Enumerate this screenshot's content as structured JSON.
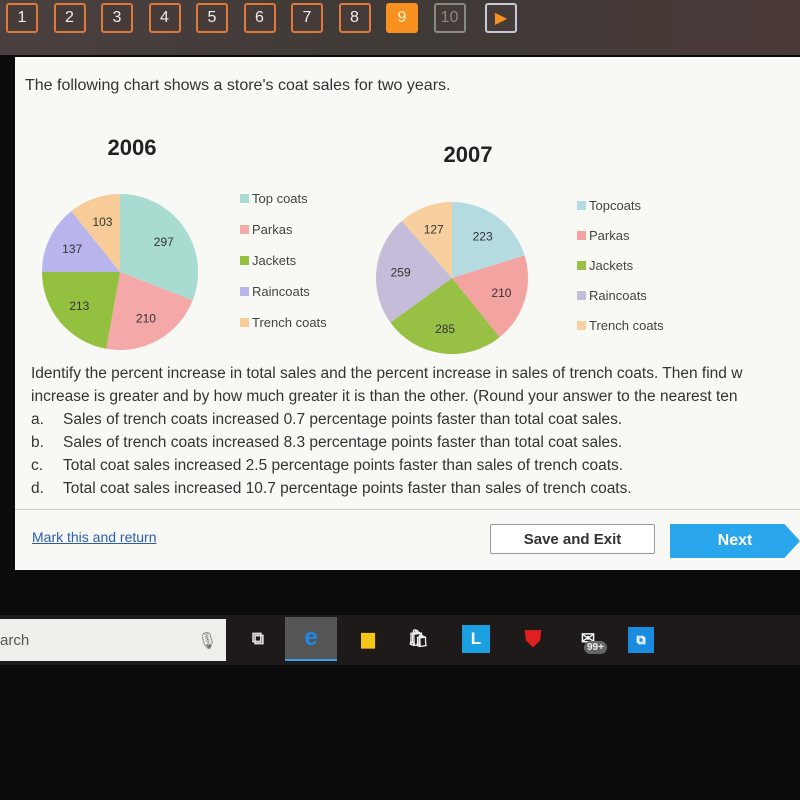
{
  "nav": {
    "questions": [
      "1",
      "2",
      "3",
      "4",
      "5",
      "6",
      "7",
      "8",
      "9",
      "10"
    ],
    "current": "9",
    "disabled": "10",
    "next_icon": "play-arrow-icon"
  },
  "intro": "The following chart shows a store's coat sales for two years.",
  "chart_data": [
    {
      "type": "pie",
      "title": "2006",
      "categories": [
        "Top coats",
        "Parkas",
        "Jackets",
        "Raincoats",
        "Trench coats"
      ],
      "values": [
        297,
        210,
        213,
        137,
        103
      ],
      "colors": [
        "#a8dcd0",
        "#f4a8a8",
        "#94c040",
        "#b8b4ec",
        "#f8cc98"
      ],
      "legend": "right"
    },
    {
      "type": "pie",
      "title": "2007",
      "categories": [
        "Topcoats",
        "Parkas",
        "Jackets",
        "Raincoats",
        "Trench coats"
      ],
      "values": [
        223,
        210,
        285,
        259,
        127
      ],
      "colors": [
        "#b4dce0",
        "#f4a4a0",
        "#98c044",
        "#c4bcd8",
        "#f8d0a0"
      ],
      "legend": "right"
    }
  ],
  "question": {
    "text1": "Identify the percent increase in total sales and the percent increase in sales of trench coats. Then find w",
    "text2": "increase is greater and by how much greater it is than the other. (Round your answer to the nearest ten",
    "options": [
      {
        "letter": "a.",
        "text": "Sales of trench coats increased 0.7 percentage points faster than total coat sales."
      },
      {
        "letter": "b.",
        "text": "Sales of trench coats increased 8.3 percentage points faster than total coat sales."
      },
      {
        "letter": "c.",
        "text": "Total coat sales increased 2.5 percentage points faster than sales of trench coats."
      },
      {
        "letter": "d.",
        "text": "Total coat sales increased 10.7 percentage points faster than sales of trench coats."
      }
    ]
  },
  "footer": {
    "mark": "Mark this and return",
    "save": "Save and Exit",
    "next": "Next"
  },
  "taskbar": {
    "search": "arch",
    "mail_badge": "99+",
    "app_l": "L"
  }
}
